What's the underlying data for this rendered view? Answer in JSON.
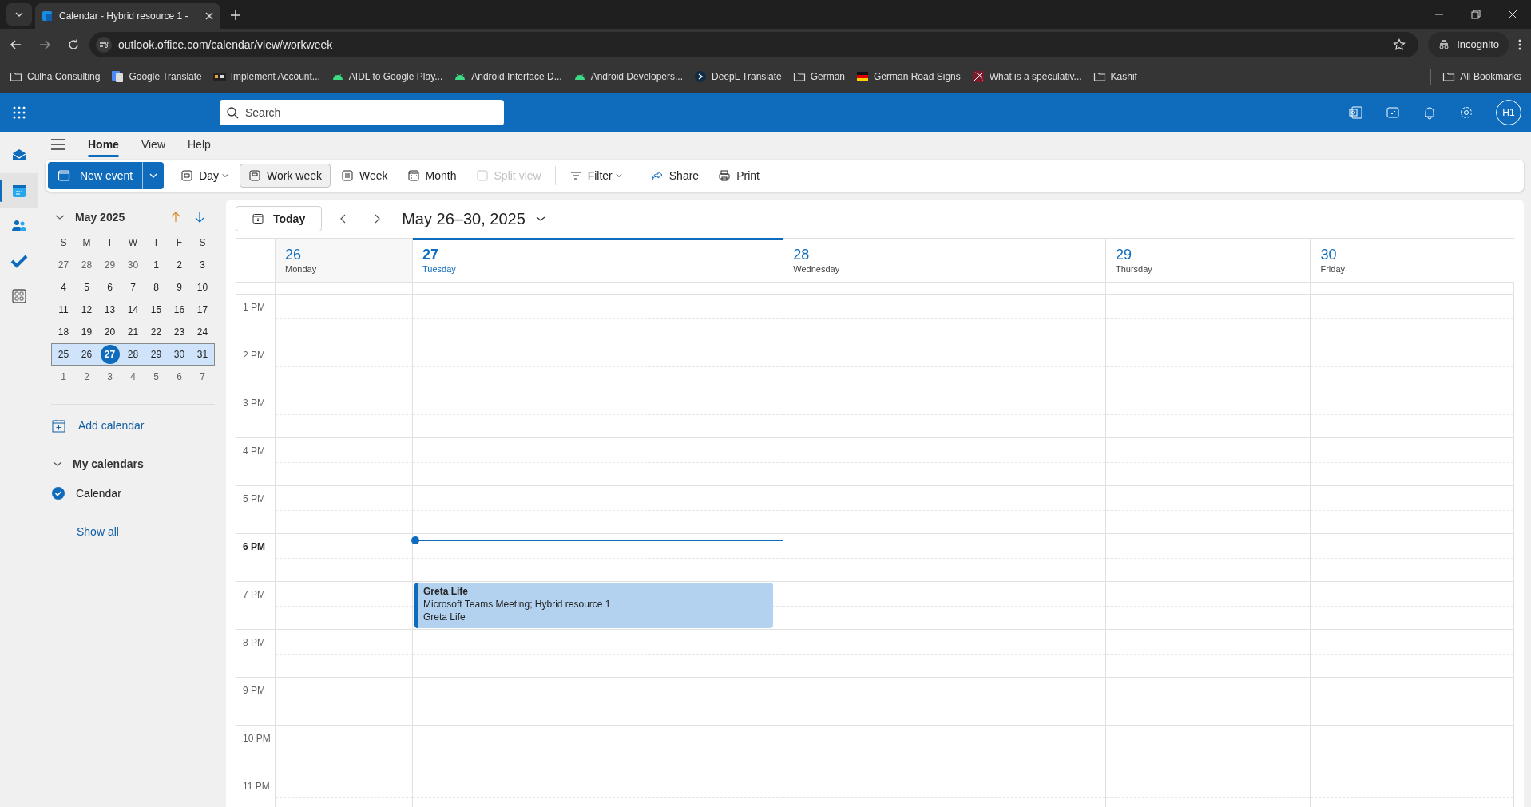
{
  "browser": {
    "tab_title": "Calendar - Hybrid resource 1 -",
    "url": "outlook.office.com/calendar/view/workweek",
    "profile": "Incognito",
    "bookmarks": [
      {
        "label": "Culha Consulting",
        "kind": "folder"
      },
      {
        "label": "Google Translate",
        "kind": "translate"
      },
      {
        "label": "Implement Account...",
        "kind": "pad"
      },
      {
        "label": "AIDL to Google Play...",
        "kind": "android"
      },
      {
        "label": "Android Interface D...",
        "kind": "android"
      },
      {
        "label": "Android Developers...",
        "kind": "android"
      },
      {
        "label": "DeepL Translate",
        "kind": "deepl"
      },
      {
        "label": "German",
        "kind": "folder"
      },
      {
        "label": "German Road Signs",
        "kind": "flag"
      },
      {
        "label": "What is a speculativ...",
        "kind": "site"
      },
      {
        "label": "Kashif",
        "kind": "folder"
      }
    ],
    "all_bookmarks": "All Bookmarks"
  },
  "header": {
    "search_placeholder": "Search",
    "avatar": "H1"
  },
  "rail": [
    {
      "kind": "mail",
      "selected": false
    },
    {
      "kind": "calendar",
      "selected": true
    },
    {
      "kind": "people",
      "selected": false
    },
    {
      "kind": "todo",
      "selected": false
    },
    {
      "kind": "apps",
      "selected": false
    }
  ],
  "ribbon_tabs": [
    {
      "label": "Home",
      "selected": true
    },
    {
      "label": "View",
      "selected": false
    },
    {
      "label": "Help",
      "selected": false
    }
  ],
  "new_event": "New event",
  "toolbar": [
    {
      "label": "Day",
      "kind": "day",
      "selected": false,
      "disabled": false,
      "dropdown": true
    },
    {
      "label": "Work week",
      "kind": "workweek",
      "selected": true,
      "disabled": false,
      "dropdown": false
    },
    {
      "label": "Week",
      "kind": "week",
      "selected": false,
      "disabled": false,
      "dropdown": false
    },
    {
      "label": "Month",
      "kind": "month",
      "selected": false,
      "disabled": false,
      "dropdown": false
    },
    {
      "label": "Split view",
      "kind": "split",
      "selected": false,
      "disabled": true,
      "dropdown": false
    },
    {
      "label": "Filter",
      "kind": "filter",
      "selected": false,
      "disabled": false,
      "dropdown": true
    },
    {
      "label": "Share",
      "kind": "share",
      "selected": false,
      "disabled": false,
      "dropdown": false
    },
    {
      "label": "Print",
      "kind": "print",
      "selected": false,
      "disabled": false,
      "dropdown": false
    }
  ],
  "mini_calendar": {
    "title": "May 2025",
    "weekdays": [
      "S",
      "M",
      "T",
      "W",
      "T",
      "F",
      "S"
    ],
    "weeks": [
      {
        "selected": false,
        "days": [
          {
            "day": "27",
            "other_month": true,
            "today": false
          },
          {
            "day": "28",
            "other_month": true,
            "today": false
          },
          {
            "day": "29",
            "other_month": true,
            "today": false
          },
          {
            "day": "30",
            "other_month": true,
            "today": false
          },
          {
            "day": "1",
            "other_month": false,
            "today": false
          },
          {
            "day": "2",
            "other_month": false,
            "today": false
          },
          {
            "day": "3",
            "other_month": false,
            "today": false
          }
        ]
      },
      {
        "selected": false,
        "days": [
          {
            "day": "4",
            "other_month": false,
            "today": false
          },
          {
            "day": "5",
            "other_month": false,
            "today": false
          },
          {
            "day": "6",
            "other_month": false,
            "today": false
          },
          {
            "day": "7",
            "other_month": false,
            "today": false
          },
          {
            "day": "8",
            "other_month": false,
            "today": false
          },
          {
            "day": "9",
            "other_month": false,
            "today": false
          },
          {
            "day": "10",
            "other_month": false,
            "today": false
          }
        ]
      },
      {
        "selected": false,
        "days": [
          {
            "day": "11",
            "other_month": false,
            "today": false
          },
          {
            "day": "12",
            "other_month": false,
            "today": false
          },
          {
            "day": "13",
            "other_month": false,
            "today": false
          },
          {
            "day": "14",
            "other_month": false,
            "today": false
          },
          {
            "day": "15",
            "other_month": false,
            "today": false
          },
          {
            "day": "16",
            "other_month": false,
            "today": false
          },
          {
            "day": "17",
            "other_month": false,
            "today": false
          }
        ]
      },
      {
        "selected": false,
        "days": [
          {
            "day": "18",
            "other_month": false,
            "today": false
          },
          {
            "day": "19",
            "other_month": false,
            "today": false
          },
          {
            "day": "20",
            "other_month": false,
            "today": false
          },
          {
            "day": "21",
            "other_month": false,
            "today": false
          },
          {
            "day": "22",
            "other_month": false,
            "today": false
          },
          {
            "day": "23",
            "other_month": false,
            "today": false
          },
          {
            "day": "24",
            "other_month": false,
            "today": false
          }
        ]
      },
      {
        "selected": true,
        "days": [
          {
            "day": "25",
            "other_month": false,
            "today": false
          },
          {
            "day": "26",
            "other_month": false,
            "today": false
          },
          {
            "day": "27",
            "other_month": false,
            "today": true
          },
          {
            "day": "28",
            "other_month": false,
            "today": false
          },
          {
            "day": "29",
            "other_month": false,
            "today": false
          },
          {
            "day": "30",
            "other_month": false,
            "today": false
          },
          {
            "day": "31",
            "other_month": false,
            "today": false
          }
        ]
      },
      {
        "selected": false,
        "days": [
          {
            "day": "1",
            "other_month": true,
            "today": false
          },
          {
            "day": "2",
            "other_month": true,
            "today": false
          },
          {
            "day": "3",
            "other_month": true,
            "today": false
          },
          {
            "day": "4",
            "other_month": true,
            "today": false
          },
          {
            "day": "5",
            "other_month": true,
            "today": false
          },
          {
            "day": "6",
            "other_month": true,
            "today": false
          },
          {
            "day": "7",
            "other_month": true,
            "today": false
          }
        ]
      }
    ]
  },
  "add_calendar": "Add calendar",
  "my_calendars": {
    "title": "My calendars",
    "expanded": true,
    "items": [
      {
        "label": "Calendar",
        "checked": true
      }
    ],
    "show_all": "Show all"
  },
  "calendar": {
    "today_button": "Today",
    "range": "May 26–30, 2025",
    "days": [
      {
        "number": "26",
        "weekday": "Monday",
        "today": false
      },
      {
        "number": "27",
        "weekday": "Tuesday",
        "today": true,
        "events": [
          {
            "title": "Greta Life",
            "details": "Microsoft Teams Meeting; Hybrid resource 1",
            "organizer": "Greta Life"
          }
        ]
      },
      {
        "number": "28",
        "weekday": "Wednesday",
        "today": false
      },
      {
        "number": "29",
        "weekday": "Thursday",
        "today": false
      },
      {
        "number": "30",
        "weekday": "Friday",
        "today": false
      }
    ],
    "hours": [
      {
        "label": "1 PM",
        "current": false
      },
      {
        "label": "2 PM",
        "current": false
      },
      {
        "label": "3 PM",
        "current": false
      },
      {
        "label": "4 PM",
        "current": false
      },
      {
        "label": "5 PM",
        "current": false
      },
      {
        "label": "6 PM",
        "current": true
      },
      {
        "label": "7 PM",
        "current": false
      },
      {
        "label": "8 PM",
        "current": false
      },
      {
        "label": "9 PM",
        "current": false
      },
      {
        "label": "10 PM",
        "current": false
      },
      {
        "label": "11 PM",
        "current": false
      }
    ]
  }
}
